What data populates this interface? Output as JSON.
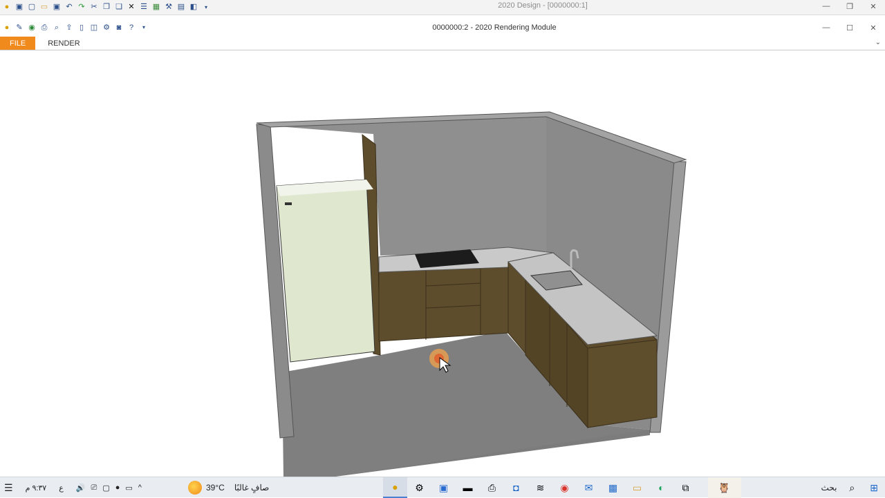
{
  "outer_window": {
    "title": "2020 Design - [0000000:1]"
  },
  "module_window": {
    "title": "0000000:2 - 2020 Rendering Module"
  },
  "ribbon": {
    "tabs": [
      {
        "label": "FILE",
        "active": true
      },
      {
        "label": "RENDER",
        "active": false
      }
    ],
    "accent_color": "#f08a1c"
  },
  "viewport": {
    "scene": "3d-kitchen-render"
  },
  "taskbar": {
    "time": "٩:٣٧ م",
    "input_language": "ع",
    "temperature": "39°C",
    "weather": "صافٍ غالبًا",
    "search_label": "بحث"
  },
  "colors": {
    "wall": "#8e8e8e",
    "cabinet": "#5e4d2c",
    "fridge": "#dfe8cf",
    "floor": "#7d7d7d"
  }
}
